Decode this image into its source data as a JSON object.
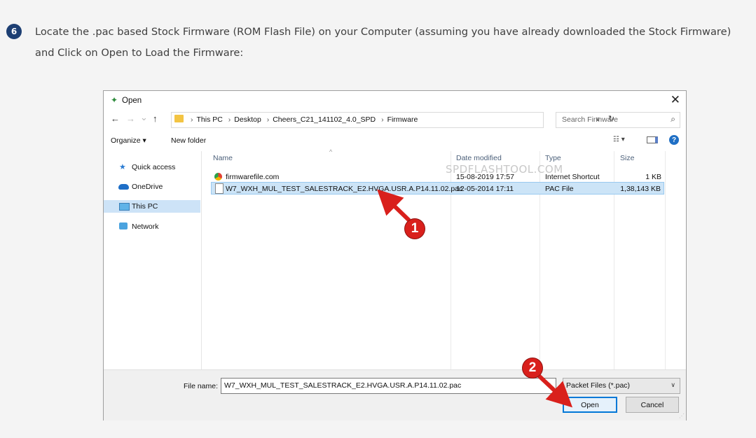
{
  "step": {
    "number": "6",
    "text": "Locate the .pac based Stock Firmware (ROM Flash File) on your Computer (assuming you have already downloaded the Stock Firmware) and Click on Open to Load the Firmware:"
  },
  "dialog": {
    "title": "Open",
    "close_glyph": "✕",
    "nav": {
      "back": "←",
      "forward": "→",
      "recent": "⌄",
      "up": "↑"
    },
    "breadcrumb": [
      "This PC",
      "Desktop",
      "Cheers_C21_141102_4.0_SPD",
      "Firmware"
    ],
    "breadcrumb_separator": "›",
    "search_placeholder": "Search Firmware",
    "toolbar": {
      "organize": "Organize ▾",
      "new_folder": "New folder"
    },
    "sidebar": [
      {
        "label": "Quick access",
        "icon": "star-icon"
      },
      {
        "label": "OneDrive",
        "icon": "cloud-icon"
      },
      {
        "label": "This PC",
        "icon": "computer-icon",
        "selected": true
      },
      {
        "label": "Network",
        "icon": "network-icon"
      }
    ],
    "columns": [
      "Name",
      "Date modified",
      "Type",
      "Size"
    ],
    "files": [
      {
        "name": "firmwarefile.com",
        "date": "15-08-2019 17:57",
        "type": "Internet Shortcut",
        "size": "1 KB",
        "icon": "chrome-icon",
        "selected": false
      },
      {
        "name": "W7_WXH_MUL_TEST_SALESTRACK_E2.HVGA.USR.A.P14.11.02.pac",
        "date": "12-05-2014 17:11",
        "type": "PAC File",
        "size": "1,38,143 KB",
        "icon": "file-icon",
        "selected": true
      }
    ],
    "watermark": "SPDFLASHTOOL.COM",
    "file_name_label": "File name:",
    "file_name_value": "W7_WXH_MUL_TEST_SALESTRACK_E2.HVGA.USR.A.P14.11.02.pac",
    "file_type": "Packet Files (*.pac)",
    "buttons": {
      "open": "Open",
      "cancel": "Cancel"
    }
  },
  "annotations": [
    "1",
    "2"
  ],
  "colors": {
    "annotation_red": "#d9201c",
    "selection": "#cce4f7",
    "step_badge": "#1d3f73"
  }
}
